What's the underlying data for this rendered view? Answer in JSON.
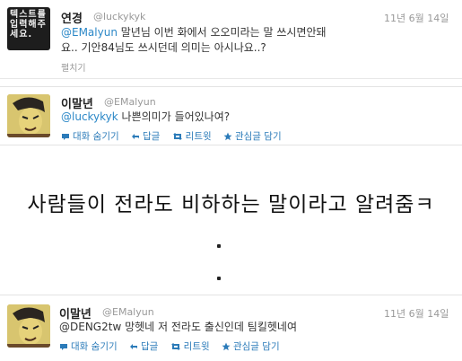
{
  "tweets": [
    {
      "avatar_text": "텍스트를 입력해주세요.",
      "name": "연경",
      "handle": "@luckykyk",
      "time": "11년 6월 14일",
      "mention": "@EMalyun",
      "line1": " 말년님 이번 화에서 오오미라는 말 쓰시면안돼",
      "line2": "요.. 기안84님도 쓰시던데 의미는 아시나요..?",
      "expand": "펼치기"
    },
    {
      "name": "이말년",
      "handle": "@EMalyun",
      "mention": "@luckykyk",
      "text": " 나쁜의미가 들어있나여?",
      "actions": [
        "대화 숨기기",
        "답글",
        "리트윗",
        "관심글 담기"
      ]
    },
    {
      "name": "이말년",
      "handle": "@EMalyun",
      "time": "11년 6월 14일",
      "mention": "@DENG2tw",
      "text": " 망헷네 저 전라도 출신인데 팀킬헷네여",
      "actions": [
        "대화 숨기기",
        "답글",
        "리트윗",
        "관심글 담기"
      ]
    }
  ],
  "caption": "사람들이 전라도 비하하는 말이라고 알려줌ㅋ",
  "colors": {
    "link": "#2b7bb9",
    "muted": "#999999"
  },
  "icons": [
    "conversation-icon",
    "reply-icon",
    "retweet-icon",
    "favorite-star-icon"
  ]
}
